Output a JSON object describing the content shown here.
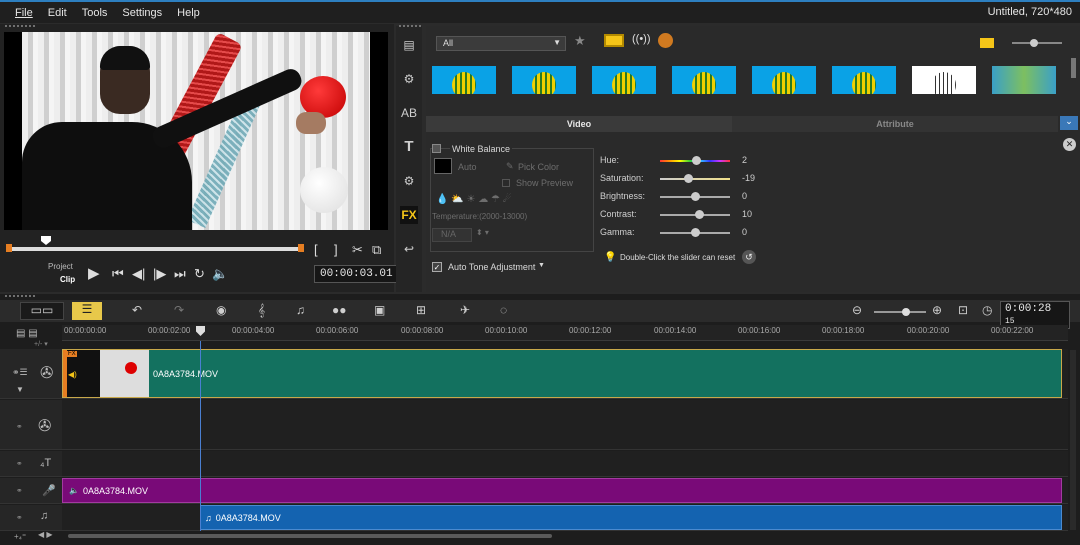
{
  "menu": {
    "items": [
      "File",
      "Edit",
      "Tools",
      "Settings",
      "Help"
    ],
    "window_title": "Untitled, 720*480"
  },
  "preview": {
    "mode_project": "Project",
    "mode_clip": "Clip",
    "timecode": "00:00:03.01",
    "icons": [
      "trim-start-icon",
      "trim-end-icon",
      "split-icon",
      "enlarge-icon",
      "play-icon",
      "home-icon",
      "prev-frame-icon",
      "next-frame-icon",
      "end-icon",
      "repeat-icon",
      "volume-icon"
    ]
  },
  "library": {
    "filter": "All",
    "thumb_count": 8,
    "tabs": {
      "video": "Video",
      "attribute": "Attribute"
    }
  },
  "white_balance": {
    "label": "White Balance",
    "auto": "Auto",
    "pick_color": "Pick Color",
    "show_preview": "Show Preview",
    "temperature": "Temperature:(2000-13000)",
    "temp_value": "N/A"
  },
  "auto_tone": "Auto Tone Adjustment",
  "adjust": [
    {
      "label": "Hue:",
      "value": "2",
      "pos": 0.52
    },
    {
      "label": "Saturation:",
      "value": "-19",
      "pos": 0.4
    },
    {
      "label": "Brightness:",
      "value": "0",
      "pos": 0.5
    },
    {
      "label": "Contrast:",
      "value": "10",
      "pos": 0.55
    },
    {
      "label": "Gamma:",
      "value": "0",
      "pos": 0.5
    }
  ],
  "reset_hint": "Double-Click the slider can reset",
  "timeline": {
    "timecode": "0:00:28",
    "timecode_unit": "15",
    "ruler": [
      "00:00:00:00",
      "00:00:02:00",
      "00:00:04:00",
      "00:00:06:00",
      "00:00:08:00",
      "00:00:10:00",
      "00:00:12:00",
      "00:00:14:00",
      "00:00:16:00",
      "00:00:18:00",
      "00:00:20:00",
      "00:00:22:00"
    ],
    "video_clip": "0A8A3784.MOV",
    "voice_clip": "0A8A3784.MOV",
    "music_clip": "0A8A3784.MOV",
    "fx_badge": "FX"
  },
  "colors": {
    "video_clip": "#13715f",
    "voice_clip": "#790a78",
    "music_clip": "#1463b0",
    "accent": "#2d7fc0"
  }
}
